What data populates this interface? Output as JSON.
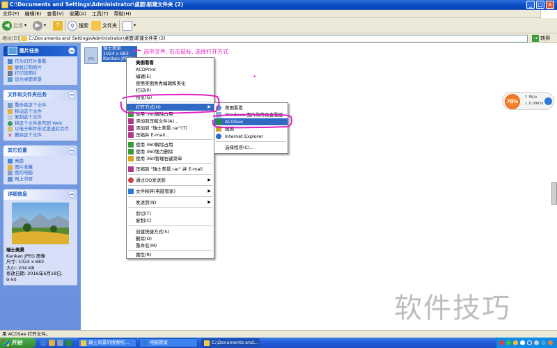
{
  "window": {
    "title": "C:\\Documents and Settings\\Administrator\\桌面\\新建文件夹 (2)"
  },
  "menubar": {
    "items": [
      "文件(F)",
      "编辑(E)",
      "查看(V)",
      "收藏(A)",
      "工具(T)",
      "帮助(H)"
    ]
  },
  "toolbar": {
    "back": "后退",
    "search": "搜索",
    "folders": "文件夹"
  },
  "addressbar": {
    "label": "地址(D)",
    "path": "C:\\Documents and Settings\\Administrator\\桌面\\新建文件夹 (2)",
    "go": "转到"
  },
  "tasks": {
    "picture_tasks": {
      "title": "图片任务",
      "items": [
        "作为幻灯片查看",
        "联机订购照片",
        "打印该图片",
        "设为桌面背景"
      ]
    },
    "file_tasks": {
      "title": "文件和文件夹任务",
      "items": [
        "重命名这个文件",
        "移动这个文件",
        "复制这个文件",
        "将这个文件发布到 Web",
        "以电子邮件形式发送此文件",
        "删除这个文件"
      ]
    },
    "other_places": {
      "title": "其它位置",
      "items": [
        "桌面",
        "图片收藏",
        "我的电脑",
        "网上邻居"
      ]
    },
    "details": {
      "title": "详细信息",
      "name": "瑞士美景",
      "type": "Kankan JPEG 图像",
      "size_dims": "尺寸: 1024 x 683",
      "filesize": "大小: 204 KB",
      "modified_label": "修改日期: 2016年6月18日,",
      "modified_time": "9:50"
    }
  },
  "file": {
    "icon_label": "JPG",
    "name": "瑞士美景",
    "dims": "1024 x 683",
    "type": "Kankan JPEG..."
  },
  "annotation": "选中文件, 右击鼠标, 选择打开方式",
  "context_menu": {
    "items": [
      "美图看看",
      "ACDPrint",
      "编辑(E)",
      "使用美图秀秀编辑和美化",
      "打印(P)",
      "预览(G)",
      "打开方式(H)",
      "使用 360解除占用",
      "添加到压缩文件(A)...",
      "添加到 \"瑞士美景.rar\"(T)",
      "压缩并 E-mail...",
      "使用 360解除占用",
      "使用 360强力删除",
      "使用 360管理右键菜单",
      "压缩到 \"瑞士美景.rar\" 并 E-mail",
      "通过QQ发送到",
      "文件粉碎(电脑管家)",
      "发送到(N)",
      "剪切(T)",
      "复制(C)",
      "创建快捷方式(S)",
      "删除(D)",
      "重命名(M)",
      "属性(R)"
    ]
  },
  "submenu": {
    "items": [
      "美图看看",
      "Windows 图片和传真查看器",
      "ACDSee",
      "画图",
      "Internet Explorer",
      "选择程序(C)..."
    ]
  },
  "net_widget": {
    "percent": "70%",
    "up": "5K/s",
    "down": "0.09K/s"
  },
  "watermark": "软件技巧",
  "statusbar": {
    "text": "用 ACDSee 打开文件。"
  },
  "taskbar": {
    "start": "开始",
    "buttons": [
      "瑞士风景的搜索结...",
      "电脑管家",
      "C:\\Documents and..."
    ]
  },
  "colors": {
    "title_blue": "#0a4fc6",
    "highlight": "#316ac5",
    "pen": "#e020c0",
    "tasks_bg": "#7aa0e5"
  }
}
